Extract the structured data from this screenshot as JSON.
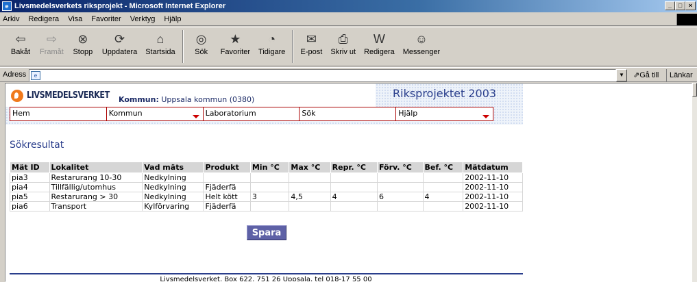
{
  "window": {
    "title": "Livsmedelsverkets riksprojekt - Microsoft Internet Explorer"
  },
  "menu": [
    "Arkiv",
    "Redigera",
    "Visa",
    "Favoriter",
    "Verktyg",
    "Hjälp"
  ],
  "toolbar": {
    "back": "Bakåt",
    "forward": "Framåt",
    "stop": "Stopp",
    "refresh": "Uppdatera",
    "home": "Startsida",
    "search": "Sök",
    "favorites": "Favoriter",
    "history": "Tidigare",
    "mail": "E-post",
    "print": "Skriv ut",
    "edit": "Redigera",
    "messenger": "Messenger"
  },
  "address": {
    "label": "Adress",
    "value": "",
    "goto": "Gå till",
    "links": "Länkar"
  },
  "page": {
    "logo": "LIVSMEDELSVERKET",
    "kommun_label": "Kommun:",
    "kommun_value": "Uppsala kommun (0380)",
    "project": "Riksprojektet 2003",
    "nav": [
      "Hem",
      "Kommun",
      "Laboratorium",
      "Sök",
      "Hjälp"
    ],
    "heading": "Sökresultat",
    "table": {
      "headers": [
        "Mät ID",
        "Lokalitet",
        "Vad mäts",
        "Produkt",
        "Min °C",
        "Max °C",
        "Repr. °C",
        "Förv. °C",
        "Bef. °C",
        "Mätdatum"
      ],
      "rows": [
        [
          "pia3",
          "Restarurang 10-30",
          "Nedkylning",
          "",
          "",
          "",
          "",
          "",
          "",
          "2002-11-10"
        ],
        [
          "pia4",
          "Tillfällig/utomhus",
          "Nedkylning",
          "Fjäderfä",
          "",
          "",
          "",
          "",
          "",
          "2002-11-10"
        ],
        [
          "pia5",
          "Restarurang > 30",
          "Nedkylning",
          "Helt kött",
          "3",
          "4,5",
          "4",
          "6",
          "4",
          "2002-11-10"
        ],
        [
          "pia6",
          "Transport",
          "Kylförvaring",
          "Fjäderfä",
          "",
          "",
          "",
          "",
          "",
          "2002-11-10"
        ]
      ]
    },
    "save_button": "Spara",
    "footer": "Livsmedelsverket, Box 622, 751 26 Uppsala, tel 018-17 55 00"
  },
  "colors": {
    "accent": "#2a3e8c",
    "button": "#5e61a6",
    "logo": "#f07a1c",
    "nav_border": "#aa0000"
  }
}
